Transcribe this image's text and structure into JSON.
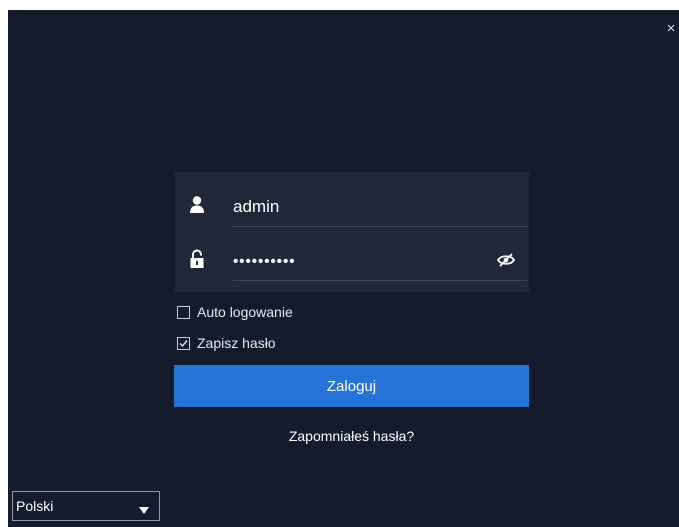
{
  "window": {
    "close_glyph": "×"
  },
  "login": {
    "username_value": "admin",
    "password_value": "••••••••••"
  },
  "options": {
    "auto_login_label": "Auto logowanie",
    "auto_login_checked": false,
    "save_password_label": "Zapisz hasło",
    "save_password_checked": true
  },
  "actions": {
    "login_button_label": "Zaloguj",
    "forgot_password_label": "Zapomniałeś hasła?"
  },
  "language": {
    "selected": "Polski"
  },
  "icons": {
    "user": "user-icon",
    "lock": "unlock-icon",
    "eye": "eye-slash-icon",
    "close": "close-icon",
    "dropdown": "triangle-down-icon"
  },
  "colors": {
    "background": "#141b2c",
    "panel": "#1f2738",
    "primary_button": "#2573d9",
    "text": "#ffffff"
  }
}
